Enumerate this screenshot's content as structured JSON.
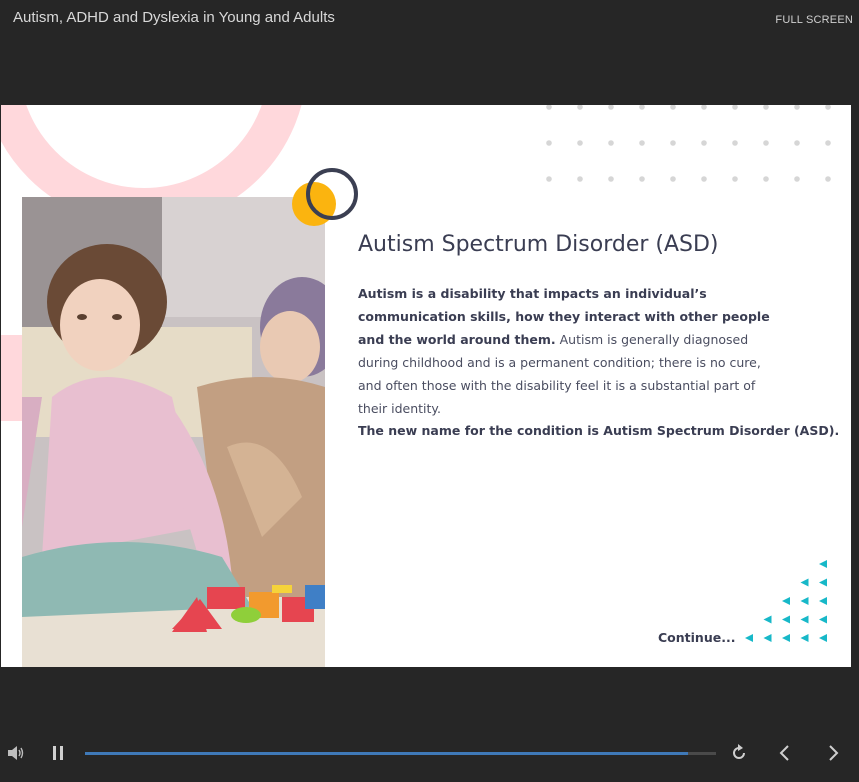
{
  "header": {
    "course_title": "Autism, ADHD and Dyslexia in Young and Adults",
    "fullscreen_label": "FULL SCREEN"
  },
  "slide": {
    "heading": "Autism Spectrum Disorder (ASD)",
    "paragraph1_bold": "Autism is a disability that impacts an individual’s communication skills, how they interact with other people and the world around them.",
    "paragraph1_rest": " Autism is generally diagnosed during childhood and is a permanent condition; there is no cure, and often those with the disability feel it is a substantial part of their identity.",
    "paragraph2": "The new name for the condition is Autism Spectrum Disorder (ASD).",
    "continue_label": "Continue...",
    "photo_icon": "photo-child-playing-blocks-with-adult",
    "colors": {
      "heading": "#3a3d52",
      "accent_pink": "#ffd8dc",
      "accent_yellow": "#fbb40f",
      "accent_teal": "#17b8c8"
    }
  },
  "player": {
    "progress_fraction": 0.955,
    "icons": {
      "volume": "volume-icon",
      "pause": "pause-icon",
      "replay": "replay-icon",
      "prev": "chevron-left-icon",
      "next": "chevron-right-icon"
    },
    "progress_color": "#3f79b8"
  }
}
